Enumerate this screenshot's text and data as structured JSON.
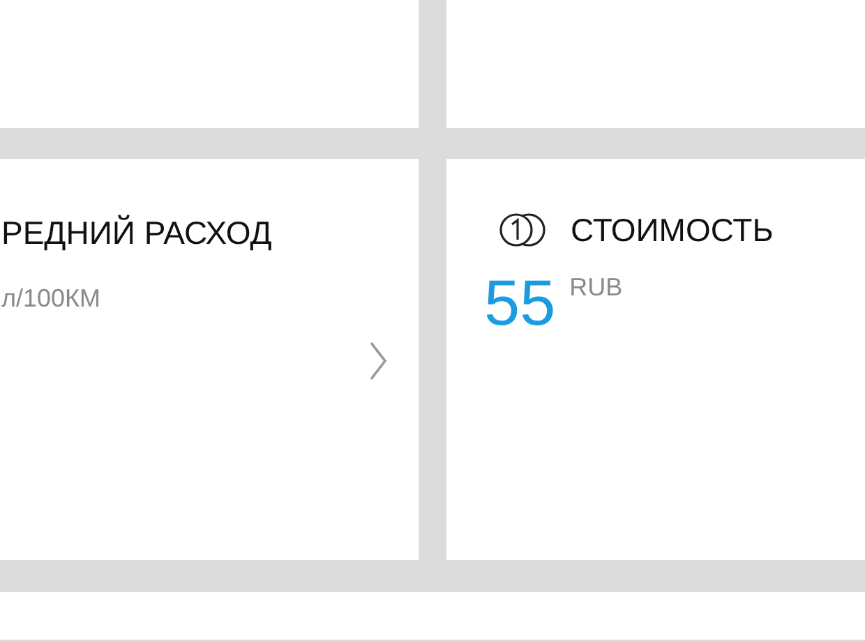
{
  "cards": [
    {
      "kind": "consumption",
      "title": "РЕДНИЙ РАСХОД",
      "unit": "л/100КМ"
    },
    {
      "kind": "cost",
      "title": "СТОИМОСТЬ",
      "value": "55",
      "unit": "RUB"
    }
  ]
}
